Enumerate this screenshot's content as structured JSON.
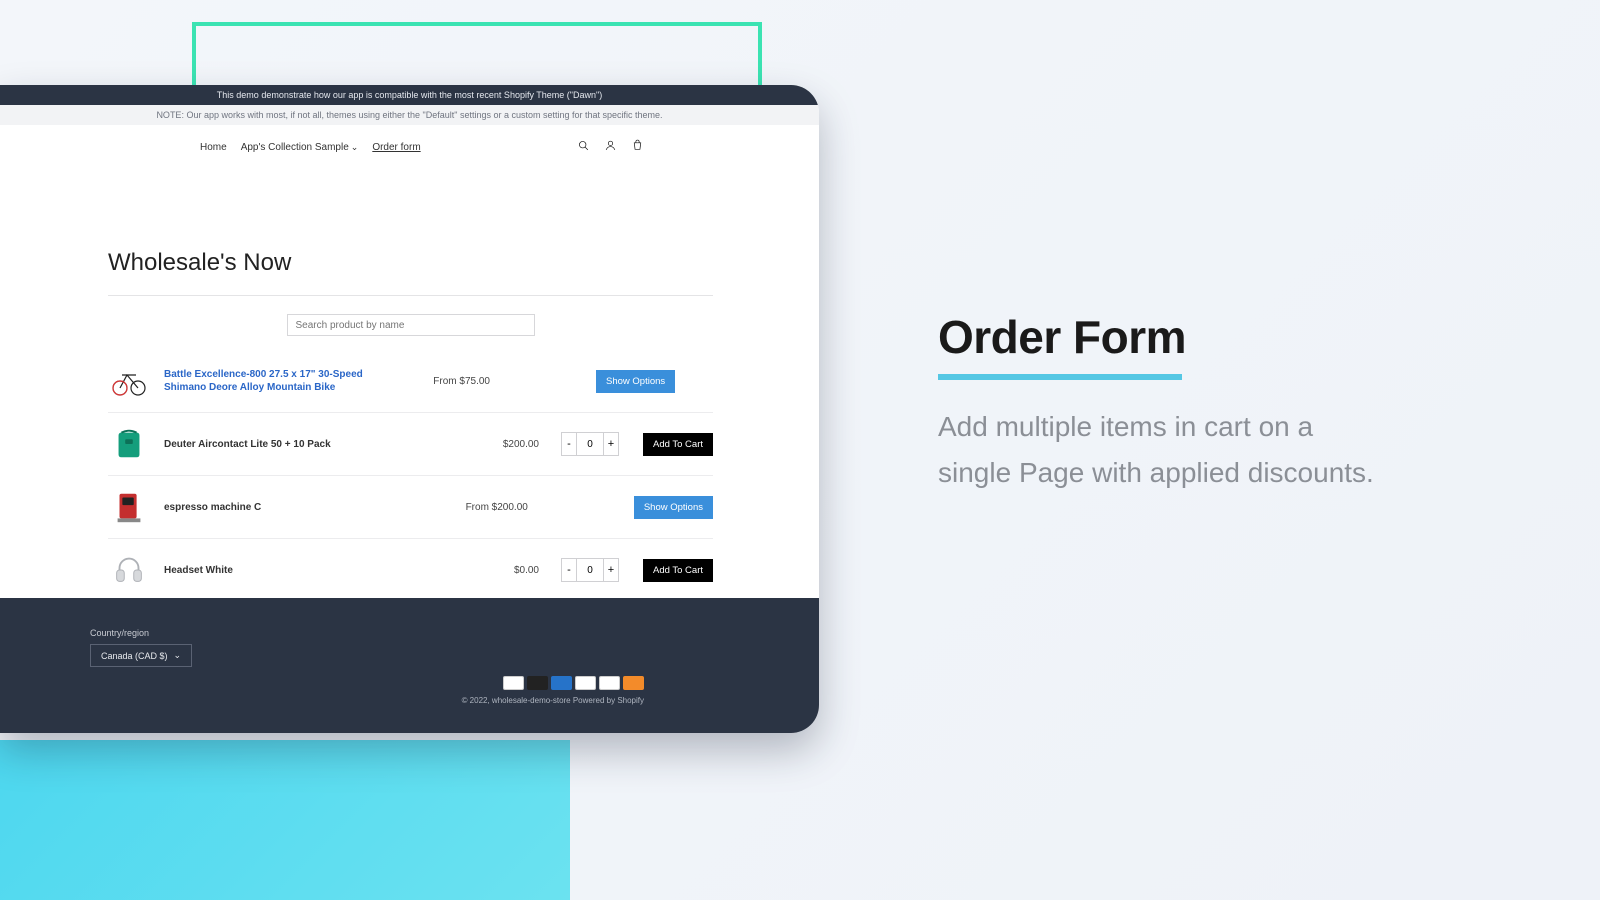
{
  "banners": {
    "dark": "This demo demonstrate how our app is compatible with the most recent Shopify Theme (\"Dawn\")",
    "light": "NOTE: Our app works with most, if not all, themes using either the \"Default\" settings or a custom setting for that specific theme."
  },
  "nav": {
    "home": "Home",
    "collection": "App's Collection Sample",
    "order_form": "Order form"
  },
  "page": {
    "title": "Wholesale's Now",
    "search_placeholder": "Search product by name"
  },
  "products": [
    {
      "name": "Battle Excellence-800 27.5 x 17\" 30-Speed Shimano Deore Alloy Mountain Bike",
      "price": "From $75.00",
      "action": "Show Options",
      "action_style": "blue",
      "has_qty": false
    },
    {
      "name": "Deuter Aircontact Lite 50 + 10 Pack",
      "price": "$200.00",
      "action": "Add To Cart",
      "action_style": "black",
      "has_qty": true,
      "qty": "0"
    },
    {
      "name": "espresso machine C",
      "price": "From $200.00",
      "action": "Show Options",
      "action_style": "blue",
      "has_qty": false
    },
    {
      "name": "Headset White",
      "price": "$0.00",
      "action": "Add To Cart",
      "action_style": "black",
      "has_qty": true,
      "qty": "0"
    }
  ],
  "footer": {
    "region_label": "Country/region",
    "region_value": "Canada (CAD $)",
    "copyright": "© 2022, wholesale-demo-store Powered by Shopify"
  },
  "marketing": {
    "heading": "Order Form",
    "body": "Add multiple items in cart on a single Page with applied discounts."
  },
  "labels": {
    "minus": "-",
    "plus": "+"
  }
}
